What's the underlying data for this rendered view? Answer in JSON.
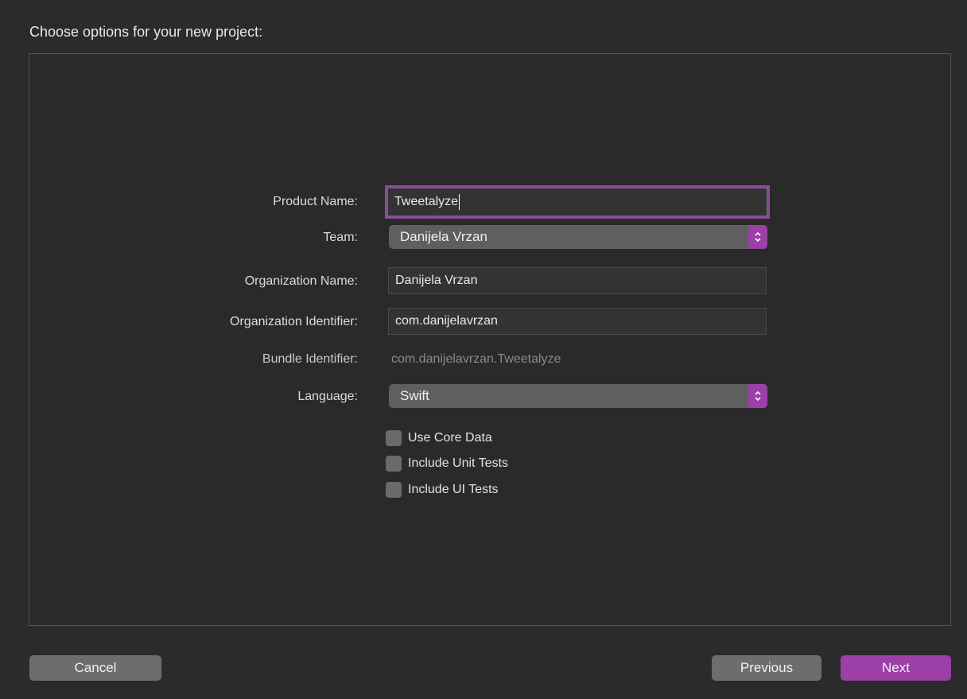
{
  "dialog": {
    "title": "Choose options for your new project:"
  },
  "form": {
    "product_name": {
      "label": "Product Name:",
      "value": "Tweetalyze"
    },
    "team": {
      "label": "Team:",
      "value": "Danijela Vrzan"
    },
    "organization_name": {
      "label": "Organization Name:",
      "value": "Danijela Vrzan"
    },
    "organization_identifier": {
      "label": "Organization Identifier:",
      "value": "com.danijelavrzan"
    },
    "bundle_identifier": {
      "label": "Bundle Identifier:",
      "value": "com.danijelavrzan.Tweetalyze"
    },
    "language": {
      "label": "Language:",
      "value": "Swift"
    },
    "options": [
      {
        "label": "Use Core Data",
        "checked": false
      },
      {
        "label": "Include Unit Tests",
        "checked": false
      },
      {
        "label": "Include UI Tests",
        "checked": false
      }
    ]
  },
  "buttons": {
    "cancel": "Cancel",
    "previous": "Previous",
    "next": "Next"
  },
  "colors": {
    "accent": "#9c3fa6",
    "focus_ring": "#8a4d96",
    "background": "#2b2b2b"
  },
  "icons": {
    "popup_stepper": "chevron-up-down-icon"
  }
}
